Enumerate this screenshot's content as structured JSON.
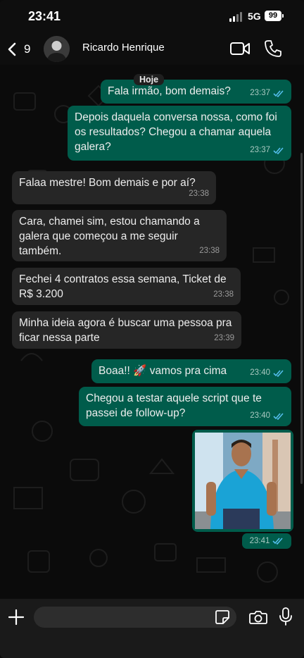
{
  "status_bar": {
    "time": "23:41",
    "network": "5G",
    "battery": "99"
  },
  "header": {
    "back_count": "9",
    "contact_name": "Ricardo Henrique",
    "icons": [
      "chevron-left-icon",
      "video-camera-icon",
      "phone-icon"
    ]
  },
  "chat": {
    "day_label": "Hoje",
    "messages": [
      {
        "direction": "outgoing",
        "text": "Fala irmão, bom demais?",
        "time": "23:37",
        "status": "read"
      },
      {
        "direction": "outgoing",
        "text": "Depois daquela conversa nossa, como foi os resultados? Chegou a chamar aquela galera?",
        "time": "23:37",
        "status": "read"
      },
      {
        "direction": "incoming",
        "text": "Falaa mestre! Bom demais e por aí?",
        "time": "23:38"
      },
      {
        "direction": "incoming",
        "text": "Cara, chamei sim, estou chamando a galera que começou a me seguir também.",
        "time": "23:38"
      },
      {
        "direction": "incoming",
        "text": "Fechei 4 contratos essa semana, Ticket de R$ 3.200",
        "time": "23:38"
      },
      {
        "direction": "incoming",
        "text": "Minha ideia agora é buscar uma pessoa pra ficar nessa parte",
        "time": "23:39"
      },
      {
        "direction": "outgoing",
        "text": "Boaa!! 🚀 vamos pra cima",
        "time": "23:40",
        "status": "read"
      },
      {
        "direction": "outgoing",
        "text": "Chegou a testar aquele script que te passei de follow-up?",
        "time": "23:40",
        "status": "read"
      },
      {
        "direction": "outgoing",
        "type": "image",
        "text": "",
        "time": "23:41",
        "status": "read"
      }
    ]
  },
  "composer": {
    "placeholder": "",
    "icons": [
      "plus-icon",
      "sticker-icon",
      "camera-icon",
      "microphone-icon"
    ]
  },
  "colors": {
    "outgoing_bubble": "#005c4b",
    "incoming_bubble": "#262626",
    "background": "#0b0b0b",
    "read_ticks": "#53bdeb"
  }
}
